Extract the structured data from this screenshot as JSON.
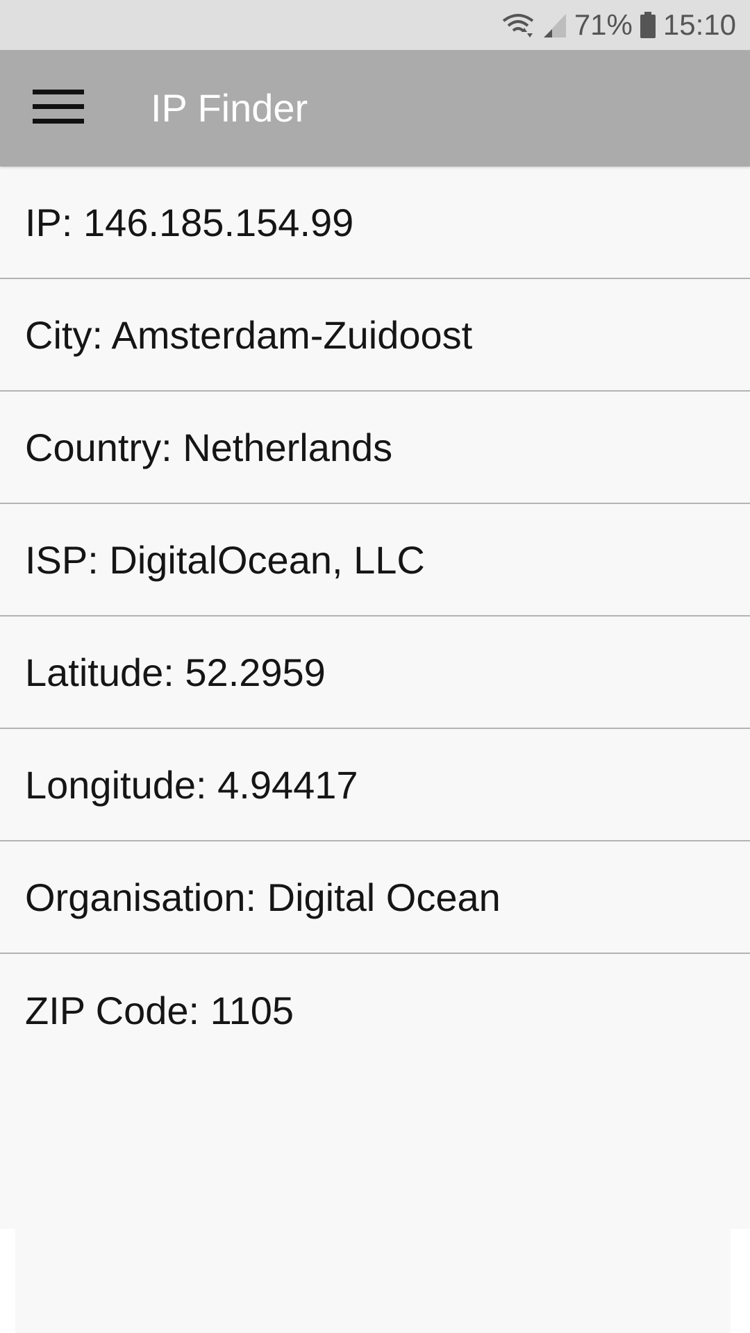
{
  "status_bar": {
    "battery_percent_label": "71%",
    "time": "15:10",
    "icons": [
      "wifi-icon",
      "signal-icon",
      "battery-icon"
    ]
  },
  "app_bar": {
    "title": "IP Finder",
    "menu_icon": "hamburger-menu-icon"
  },
  "info": {
    "rows": [
      {
        "text": "IP: 146.185.154.99"
      },
      {
        "text": "City: Amsterdam-Zuidoost"
      },
      {
        "text": "Country: Netherlands"
      },
      {
        "text": "ISP: DigitalOcean, LLC"
      },
      {
        "text": "Latitude: 52.2959"
      },
      {
        "text": "Longitude: 4.94417"
      },
      {
        "text": "Organisation: Digital Ocean"
      },
      {
        "text": "ZIP Code: 1105"
      }
    ]
  },
  "colors": {
    "status_bar_bg": "#dfdfdf",
    "app_bar_bg": "#ababab",
    "content_bg": "#f8f8f8",
    "divider": "#b3b3b3",
    "text": "#151515"
  }
}
